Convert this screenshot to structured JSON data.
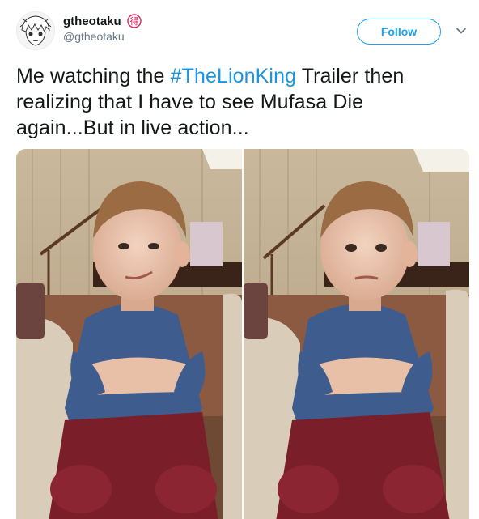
{
  "user": {
    "display_name": "gtheotaku",
    "badge_glyph": "得",
    "handle": "@gtheotaku"
  },
  "actions": {
    "follow_label": "Follow"
  },
  "tweet": {
    "text_before": "Me watching the ",
    "hashtag": "#TheLionKing",
    "text_after": " Trailer then realizing that I have to see Mufasa Die again...But in live action..."
  },
  "colors": {
    "accent": "#1da1f2",
    "hashtag": "#1b95e0",
    "badge": "#e0245e"
  }
}
